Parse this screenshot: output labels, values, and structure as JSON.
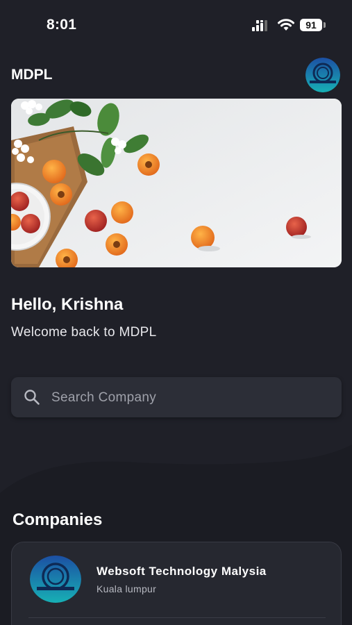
{
  "status_bar": {
    "time": "8:01",
    "battery": "91"
  },
  "header": {
    "title": "MDPL",
    "avatar_icon": "profile-avatar-icon"
  },
  "greeting": {
    "title": "Hello, Krishna",
    "subtitle": "Welcome back to MDPL"
  },
  "search": {
    "placeholder": "Search Company",
    "icon": "search-icon"
  },
  "companies": {
    "section_title": "Companies",
    "items": [
      {
        "name": "Websoft Technology Malysia",
        "location": "Kuala lumpur"
      }
    ]
  },
  "colors": {
    "background": "#1f2028",
    "card": "#262830",
    "search_bg": "#2c2e37",
    "accent_teal": "#1aa6b8",
    "accent_blue": "#1c4fa3"
  }
}
